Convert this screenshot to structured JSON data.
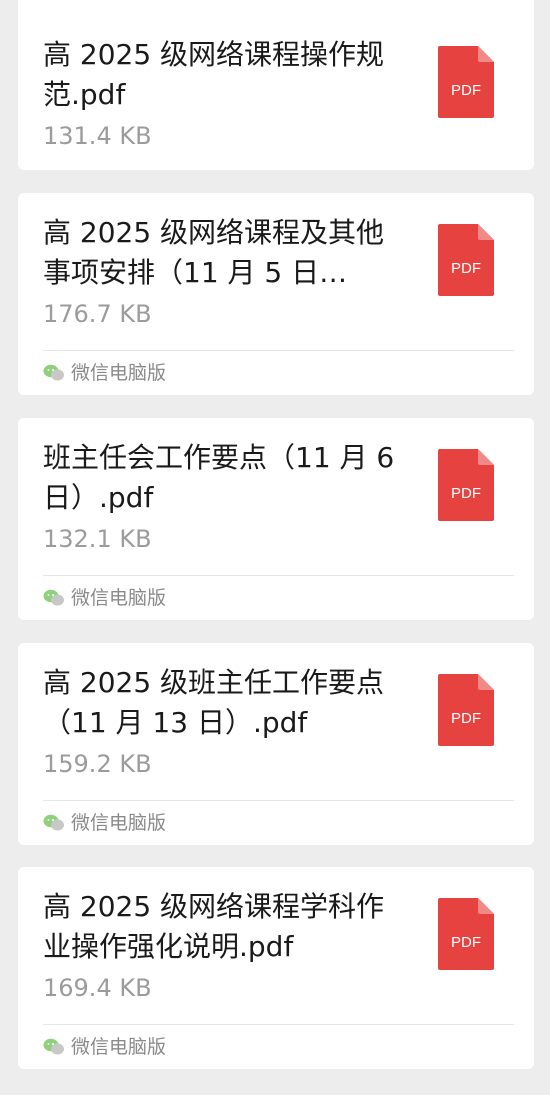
{
  "files": [
    {
      "title": "高 2025 级网络课程操作规范.pdf",
      "size": "131.4 KB",
      "icon": "pdf-file-icon",
      "icon_label": "PDF",
      "source": ""
    },
    {
      "title": "高 2025 级网络课程及其他事项安排（11 月 5 日…",
      "size": "176.7 KB",
      "icon": "pdf-file-icon",
      "icon_label": "PDF",
      "source": "微信电脑版"
    },
    {
      "title": "班主任会工作要点（11 月 6 日）.pdf",
      "size": "132.1 KB",
      "icon": "pdf-file-icon",
      "icon_label": "PDF",
      "source": "微信电脑版"
    },
    {
      "title": "高 2025 级班主任工作要点（11 月 13 日）.pdf",
      "size": "159.2 KB",
      "icon": "pdf-file-icon",
      "icon_label": "PDF",
      "source": "微信电脑版"
    },
    {
      "title": "高 2025 级网络课程学科作业操作强化说明.pdf",
      "size": "169.4 KB",
      "icon": "pdf-file-icon",
      "icon_label": "PDF",
      "source": "微信电脑版"
    }
  ],
  "colors": {
    "pdf_red": "#e64340",
    "background": "#ededed",
    "card": "#ffffff",
    "wechat_green": "#8fd07a"
  }
}
